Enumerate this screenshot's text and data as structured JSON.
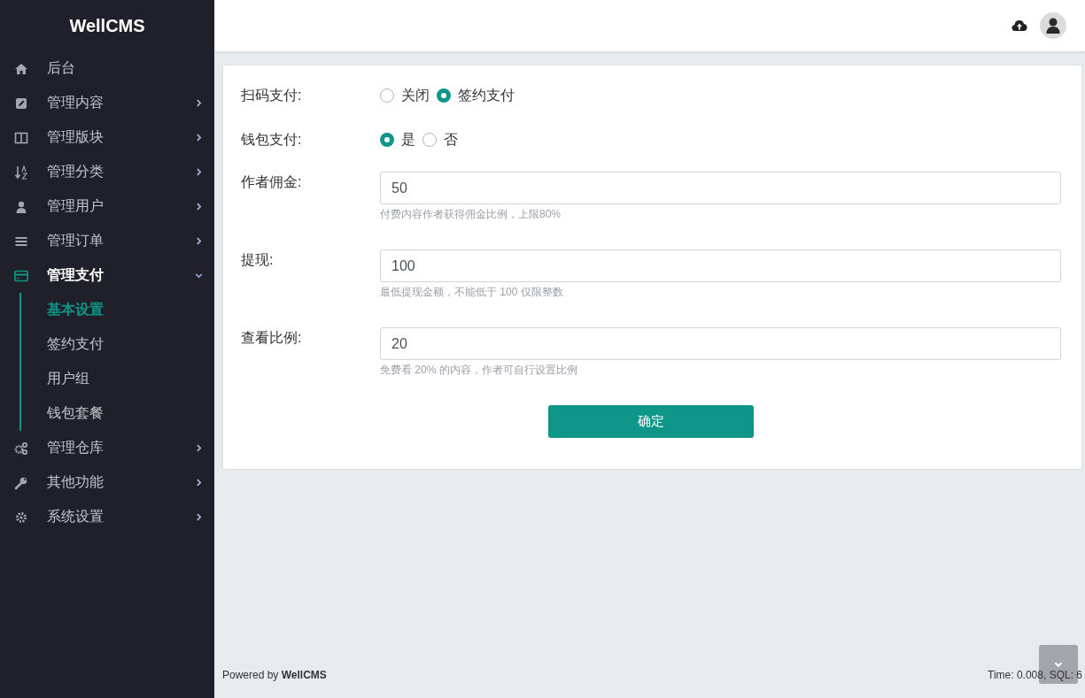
{
  "sidebar": {
    "brand": "WellCMS",
    "items": [
      {
        "label": "后台",
        "selected": false,
        "expandable": false
      },
      {
        "label": "管理内容",
        "selected": false,
        "expandable": true,
        "expanded": false
      },
      {
        "label": "管理版块",
        "selected": false,
        "expandable": true,
        "expanded": false
      },
      {
        "label": "管理分类",
        "selected": false,
        "expandable": true,
        "expanded": false
      },
      {
        "label": "管理用户",
        "selected": false,
        "expandable": true,
        "expanded": false
      },
      {
        "label": "管理订单",
        "selected": false,
        "expandable": true,
        "expanded": false
      },
      {
        "label": "管理支付",
        "selected": true,
        "expandable": true,
        "expanded": true,
        "children": [
          {
            "label": "基本设置",
            "selected": true
          },
          {
            "label": "签约支付",
            "selected": false
          },
          {
            "label": "用户组",
            "selected": false
          },
          {
            "label": "钱包套餐",
            "selected": false
          }
        ]
      },
      {
        "label": "管理仓库",
        "selected": false,
        "expandable": true,
        "expanded": false
      },
      {
        "label": "其他功能",
        "selected": false,
        "expandable": true,
        "expanded": false
      },
      {
        "label": "系统设置",
        "selected": false,
        "expandable": true,
        "expanded": false
      }
    ]
  },
  "form": {
    "fields": [
      {
        "kind": "radio",
        "label": "扫码支付:",
        "options": [
          {
            "label": "关闭",
            "selected": false
          },
          {
            "label": "签约支付",
            "selected": true
          }
        ]
      },
      {
        "kind": "radio",
        "label": "钱包支付:",
        "options": [
          {
            "label": "是",
            "selected": true
          },
          {
            "label": "否",
            "selected": false
          }
        ]
      },
      {
        "kind": "input",
        "label": "作者佣金:",
        "value": "50",
        "help": "付费内容作者获得佣金比例，上限80%"
      },
      {
        "kind": "input",
        "label": "提现:",
        "value": "100",
        "help": "最低提现金额，不能低于 100 仅限整数"
      },
      {
        "kind": "input",
        "label": "查看比例:",
        "value": "20",
        "help": "免费看 20% 的内容，作者可自行设置比例"
      }
    ],
    "submit": "确定"
  },
  "footer": {
    "powered": "Powered by **WellCMS**",
    "stats": "Time: 0.008, SQL: 6"
  }
}
